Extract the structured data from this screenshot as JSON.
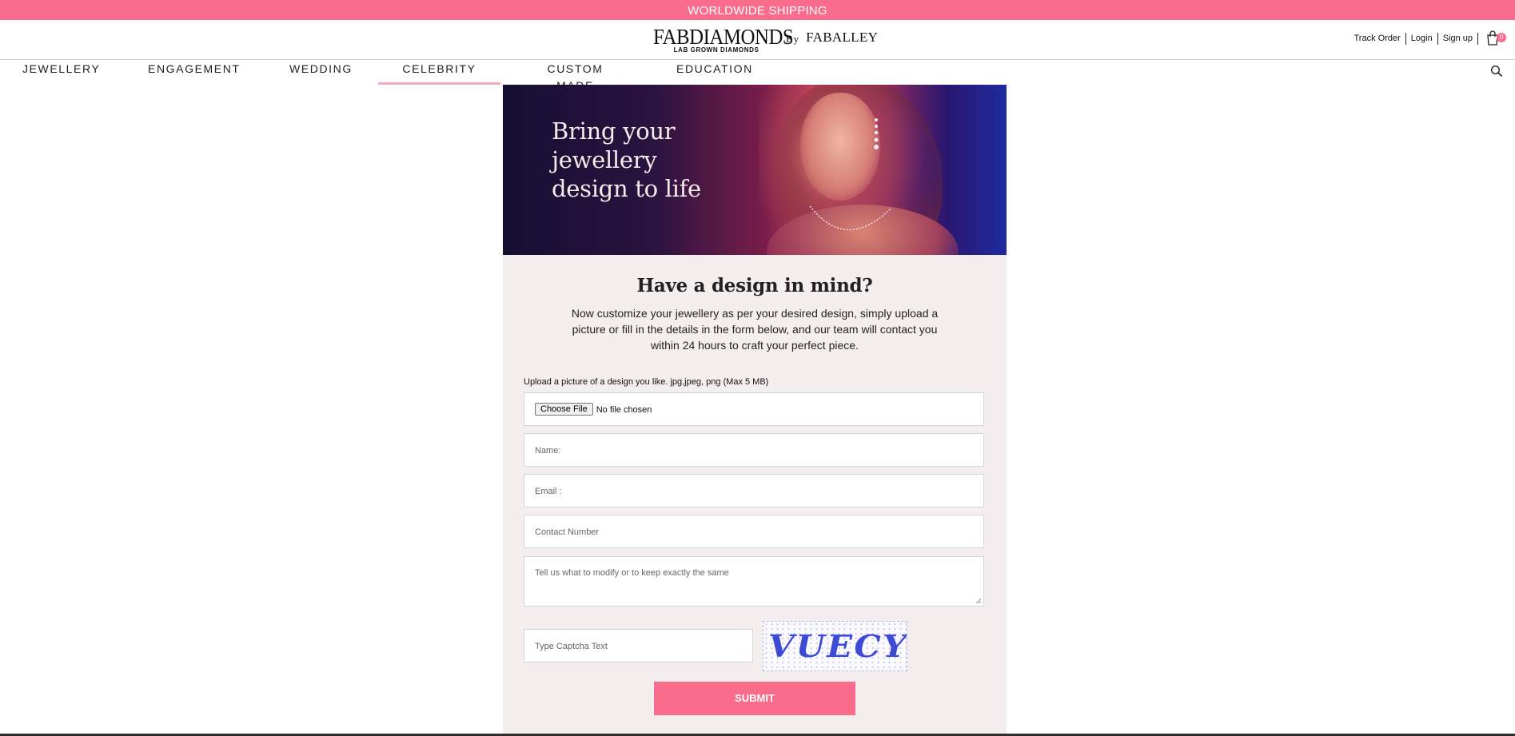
{
  "topbar": {
    "text": "WORLDWIDE SHIPPING"
  },
  "header": {
    "logo_title": "FABDIAMONDS",
    "logo_sub": "LAB GROWN DIAMONDS",
    "logo_by": "By",
    "logo_brand": "FABALLEY",
    "links": [
      "Track Order",
      "Login",
      "Sign up"
    ],
    "cart_count": "0"
  },
  "nav": {
    "items": [
      "JEWELLERY",
      "ENGAGEMENT",
      "WEDDING",
      "CELEBRITY",
      "CUSTOM MADE",
      "EDUCATION"
    ],
    "active": "CELEBRITY"
  },
  "banner": {
    "line1": "Bring your",
    "line2": "jewellery",
    "line3": "design to life"
  },
  "form": {
    "heading": "Have a design in mind?",
    "description": "Now customize your jewellery as per your desired design,  simply upload a picture or fill in the  details in the form below, and our team will contact you within 24 hours to craft your perfect piece.",
    "upload_label": "Upload a picture of a design you like. jpg,jpeg, png (Max 5 MB)",
    "choose_file": "Choose File",
    "no_file": "No file chosen",
    "name_placeholder": "Name:",
    "email_placeholder": "Email :",
    "contact_placeholder": "Contact Number",
    "message_placeholder": "Tell us what to modify or to keep exactly the same",
    "captcha_placeholder": "Type Captcha Text",
    "captcha_code": "VUECY",
    "submit_label": "SUBMIT"
  },
  "colors": {
    "accent": "#fa6c8c",
    "panel_bg": "#f5eeef",
    "nav_underline": "#f8a9bb"
  }
}
